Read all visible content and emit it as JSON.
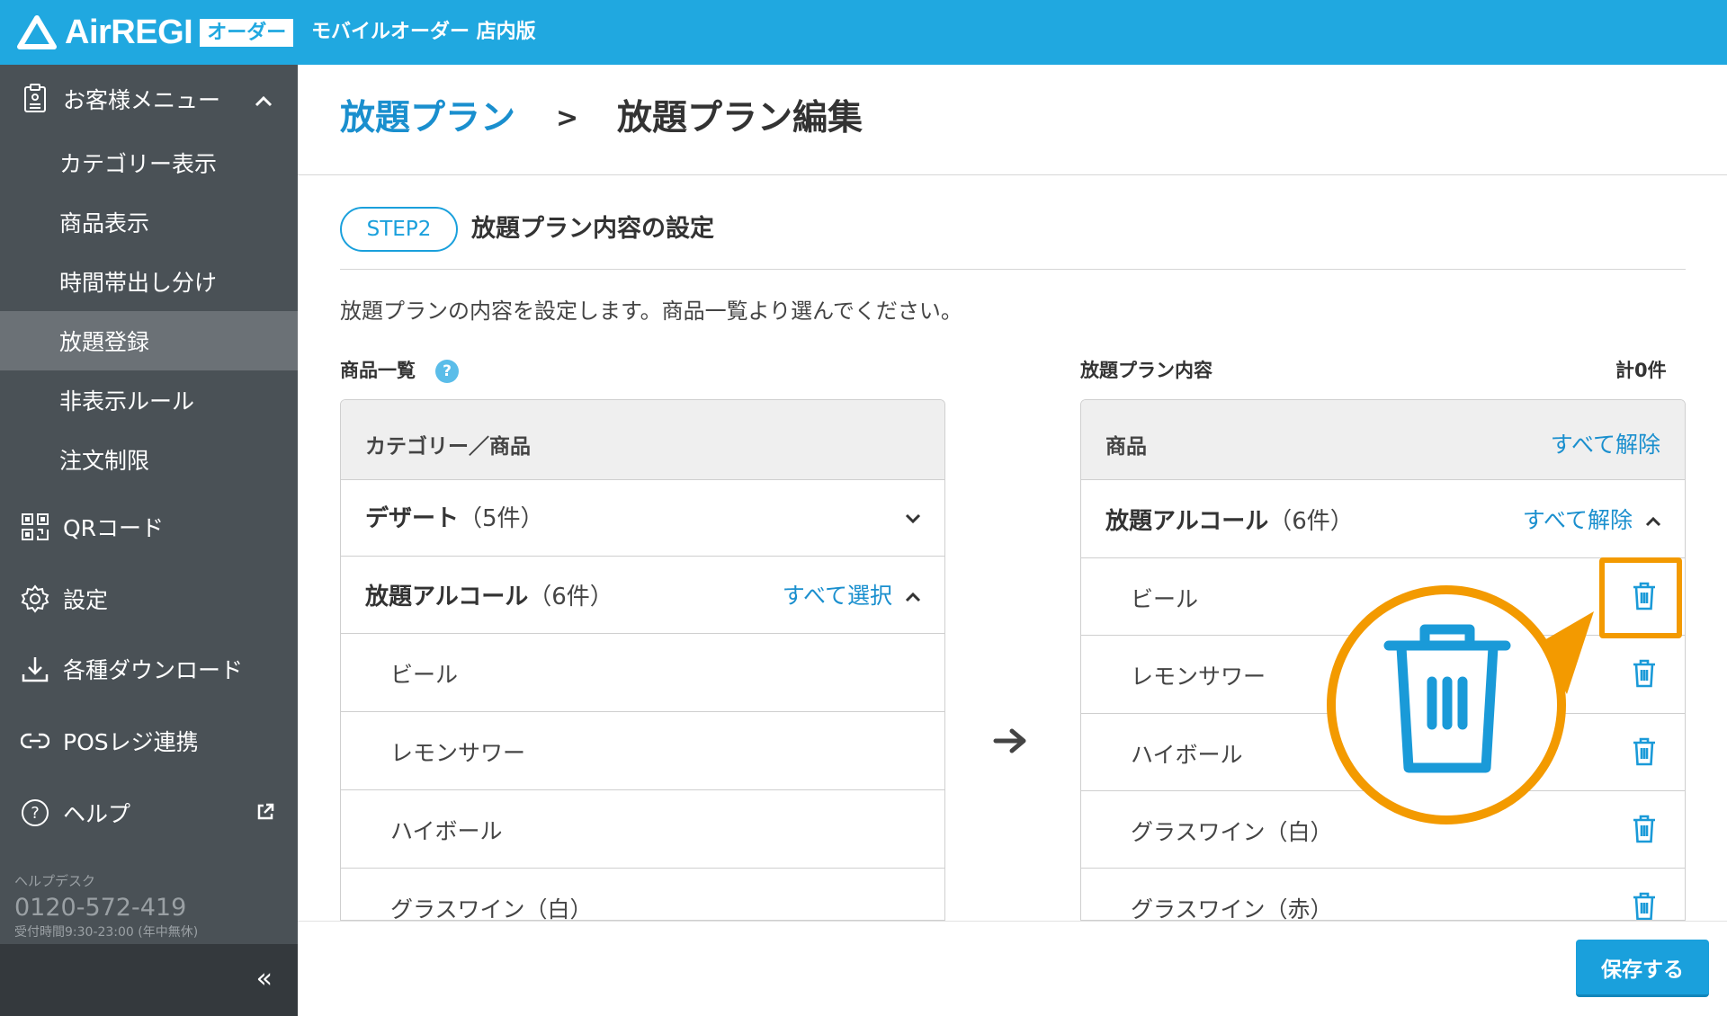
{
  "header": {
    "brand": "AirREGI",
    "badge": "オーダー",
    "app_title": "モバイルオーダー 店内版"
  },
  "sidebar": {
    "menu_label": "お客様メニュー",
    "sub_items": [
      {
        "label": "カテゴリー表示"
      },
      {
        "label": "商品表示"
      },
      {
        "label": "時間帯出し分け"
      },
      {
        "label": "放題登録",
        "active": true
      },
      {
        "label": "非表示ルール"
      },
      {
        "label": "注文制限"
      }
    ],
    "items": [
      {
        "label": "QRコード",
        "icon": "qr-code-icon"
      },
      {
        "label": "設定",
        "icon": "gear-icon"
      },
      {
        "label": "各種ダウンロード",
        "icon": "download-icon"
      },
      {
        "label": "POSレジ連携",
        "icon": "link-icon"
      },
      {
        "label": "ヘルプ",
        "icon": "help-icon"
      }
    ],
    "helpdesk": {
      "label": "ヘルプデスク",
      "phone": "0120-572-419",
      "hours": "受付時間9:30-23:00 (年中無休)"
    },
    "collapse_label": "«"
  },
  "breadcrumb": {
    "parent": "放題プラン",
    "separator": ">",
    "current": "放題プラン編集"
  },
  "step": {
    "pill": "STEP2",
    "title": "放題プラン内容の設定",
    "description": "放題プランの内容を設定します。商品一覧より選んでください。"
  },
  "left_panel": {
    "section_label": "商品一覧",
    "help_mark": "?",
    "header": "カテゴリー／商品",
    "categories": [
      {
        "name": "デザート",
        "count": "（5件）",
        "expanded": false
      },
      {
        "name": "放題アルコール",
        "count": "（6件）",
        "expanded": true,
        "action": "すべて選択"
      }
    ],
    "items": [
      "ビール",
      "レモンサワー",
      "ハイボール",
      "グラスワイン（白）"
    ]
  },
  "right_panel": {
    "section_label": "放題プラン内容",
    "total": "計0件",
    "header": "商品",
    "header_action": "すべて解除",
    "category": {
      "name": "放題アルコール",
      "count": "（6件）",
      "action": "すべて解除"
    },
    "items": [
      "ビール",
      "レモンサワー",
      "ハイボール",
      "グラスワイン（白）",
      "グラスワイン（赤）"
    ],
    "item_icon": "trash-icon"
  },
  "footer": {
    "save_label": "保存する"
  },
  "colors": {
    "brand_blue": "#20a8e0",
    "link_blue": "#1a8fce",
    "sidebar_bg": "#4a5156",
    "highlight_orange": "#f39a00"
  }
}
